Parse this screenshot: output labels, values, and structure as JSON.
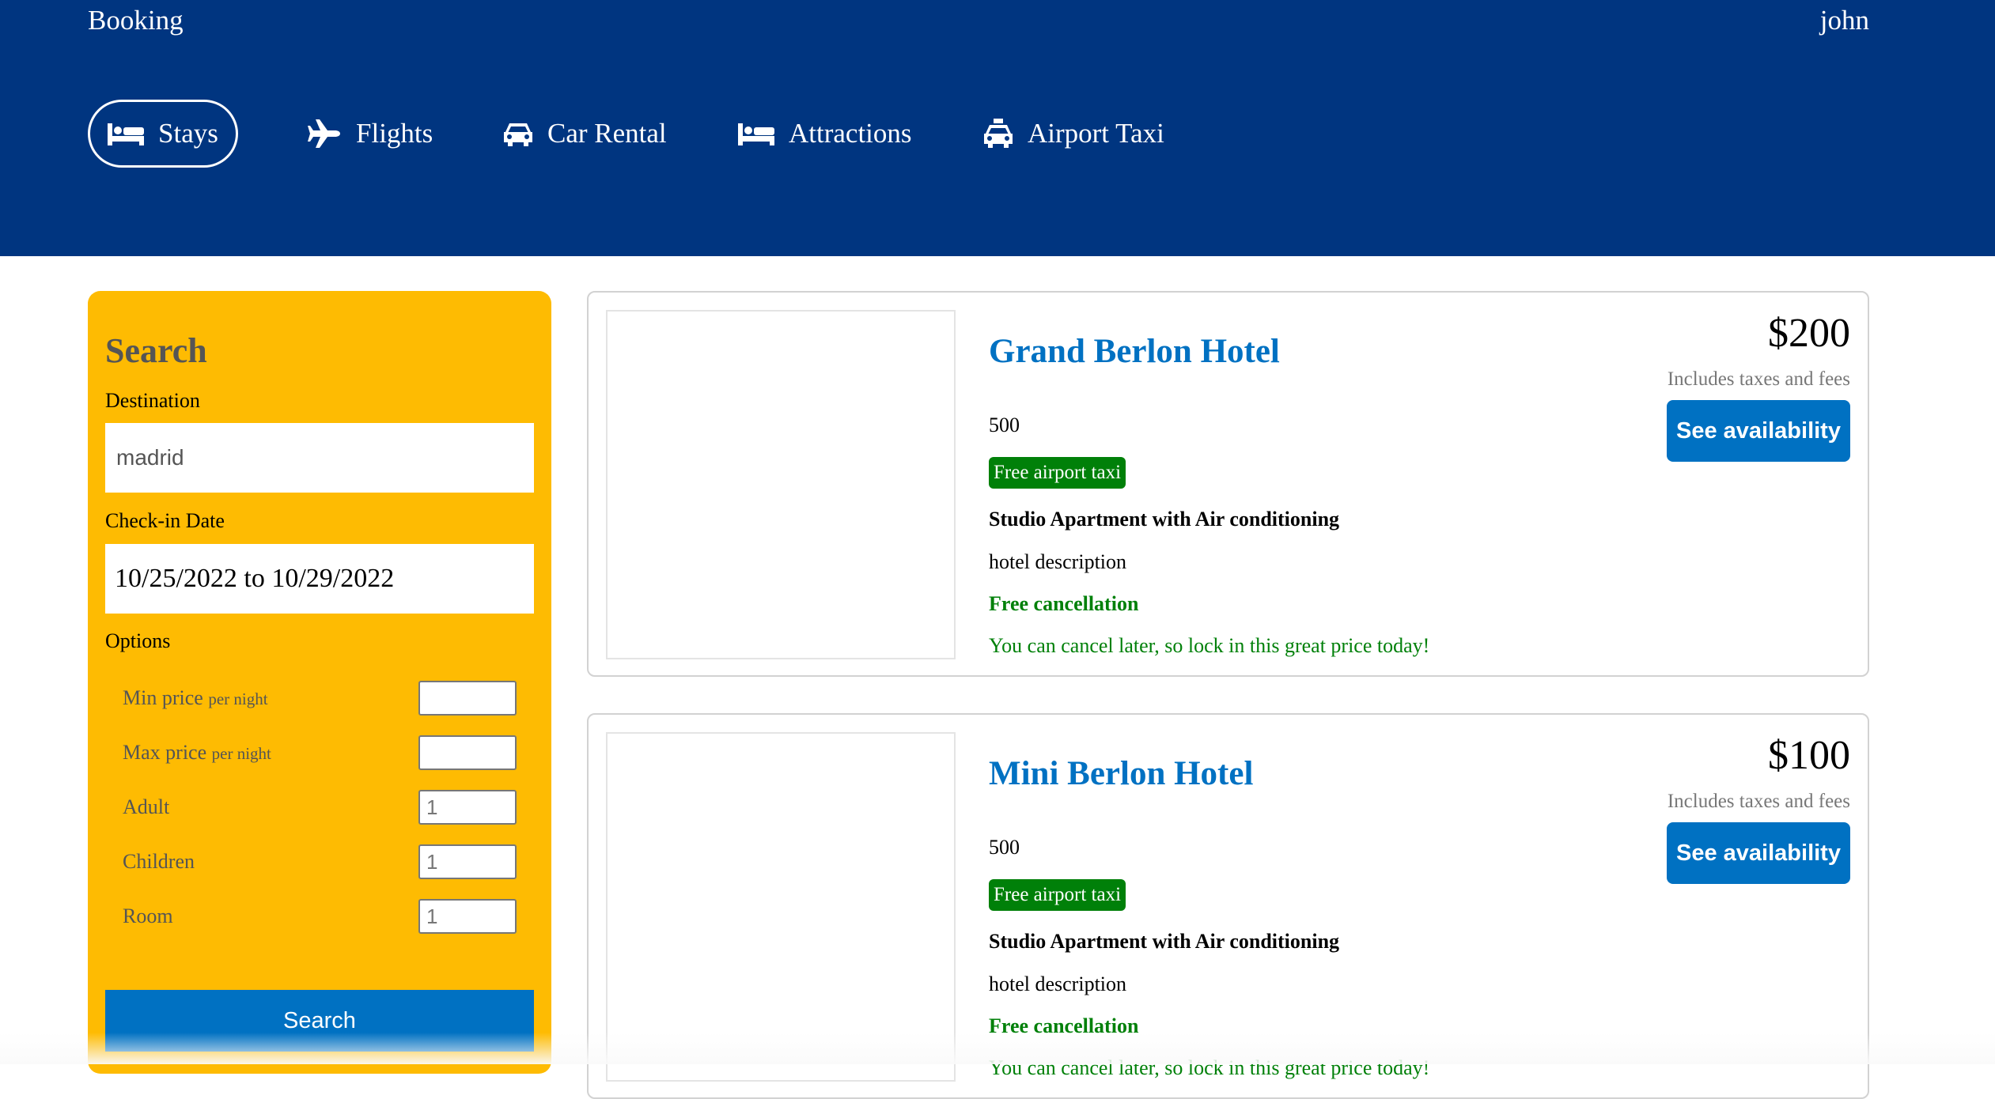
{
  "header": {
    "brand": "Booking",
    "user": "john",
    "nav": [
      {
        "label": "Stays",
        "icon": "bed-icon",
        "active": true
      },
      {
        "label": "Flights",
        "icon": "plane-icon",
        "active": false
      },
      {
        "label": "Car Rental",
        "icon": "car-icon",
        "active": false
      },
      {
        "label": "Attractions",
        "icon": "bed-icon",
        "active": false
      },
      {
        "label": "Airport Taxi",
        "icon": "taxi-icon",
        "active": false
      }
    ]
  },
  "search": {
    "title": "Search",
    "destination_label": "Destination",
    "destination_value": "madrid",
    "checkin_label": "Check-in Date",
    "checkin_value": "10/25/2022 to 10/29/2022",
    "options_label": "Options",
    "per_night": "per night",
    "options": [
      {
        "label": "Min price",
        "suffix": "per night",
        "value": ""
      },
      {
        "label": "Max price",
        "suffix": "per night",
        "value": ""
      },
      {
        "label": "Adult",
        "value": "1"
      },
      {
        "label": "Children",
        "value": "1"
      },
      {
        "label": "Room",
        "value": "1"
      }
    ],
    "button_label": "Search"
  },
  "results": [
    {
      "name": "Grand Berlon Hotel",
      "distance": "500",
      "taxi_badge": "Free airport taxi",
      "room_type": "Studio Apartment with Air conditioning",
      "description": "hotel description",
      "cancel_title": "Free cancellation",
      "cancel_subtitle": "You can cancel later, so lock in this great price today!",
      "price": "$200",
      "taxes_note": "Includes taxes and fees",
      "button_label": "See availability"
    },
    {
      "name": "Mini Berlon Hotel",
      "distance": "500",
      "taxi_badge": "Free airport taxi",
      "room_type": "Studio Apartment with Air conditioning",
      "description": "hotel description",
      "cancel_title": "Free cancellation",
      "cancel_subtitle": "You can cancel later, so lock in this great price today!",
      "price": "$100",
      "taxes_note": "Includes taxes and fees",
      "button_label": "See availability"
    }
  ],
  "colors": {
    "header_bg": "#003580",
    "search_bg": "#febb02",
    "primary_blue": "#0071c2",
    "success_green": "#008009"
  }
}
